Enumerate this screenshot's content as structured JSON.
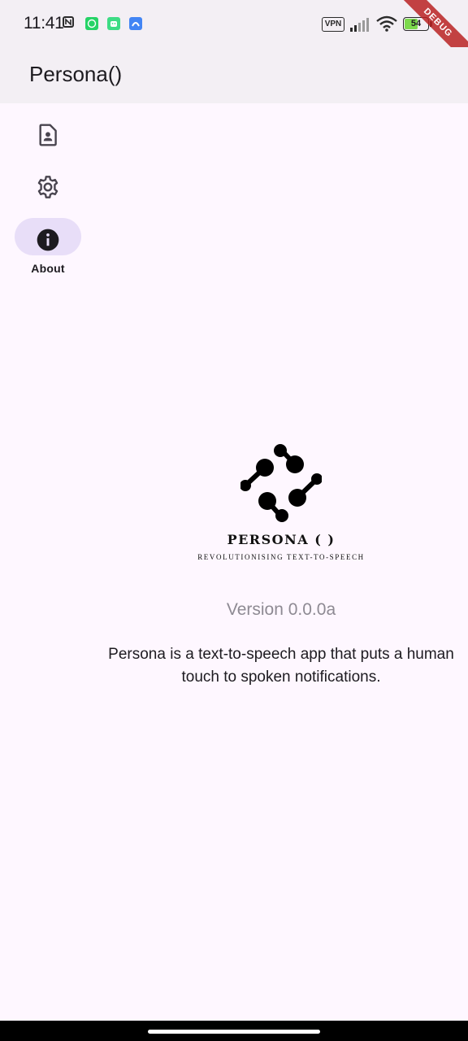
{
  "status_bar": {
    "time": "11:41",
    "vpn_label": "VPN",
    "battery_level": "54",
    "notification_icons": [
      "nfc-icon",
      "whatsapp-icon",
      "android-icon",
      "app-icon"
    ],
    "colors": {
      "whatsapp": "#25D366",
      "android": "#3DDC84",
      "app": "#4285F4",
      "battery_fill": "#7CD94D"
    }
  },
  "debug_banner": {
    "label": "DEBUG"
  },
  "app_bar": {
    "title": "Persona()"
  },
  "nav_rail": {
    "items": [
      {
        "icon": "profile-document-icon",
        "label": ""
      },
      {
        "icon": "gear-icon",
        "label": ""
      },
      {
        "icon": "info-icon",
        "label": "About",
        "selected": true
      }
    ]
  },
  "about": {
    "logo_title": "PERSONA ( )",
    "logo_tagline": "REVOLUTIONISING TEXT-TO-SPEECH",
    "version": "Version 0.0.0a",
    "description": "Persona is a text-to-speech app that puts a human touch to spoken notifications."
  },
  "colors": {
    "background": "#FEF7FF",
    "surface_container": "#F3EFF4",
    "selected_indicator": "#E8DEF8",
    "on_surface": "#1D1B20",
    "version_text": "#8E8A93"
  }
}
